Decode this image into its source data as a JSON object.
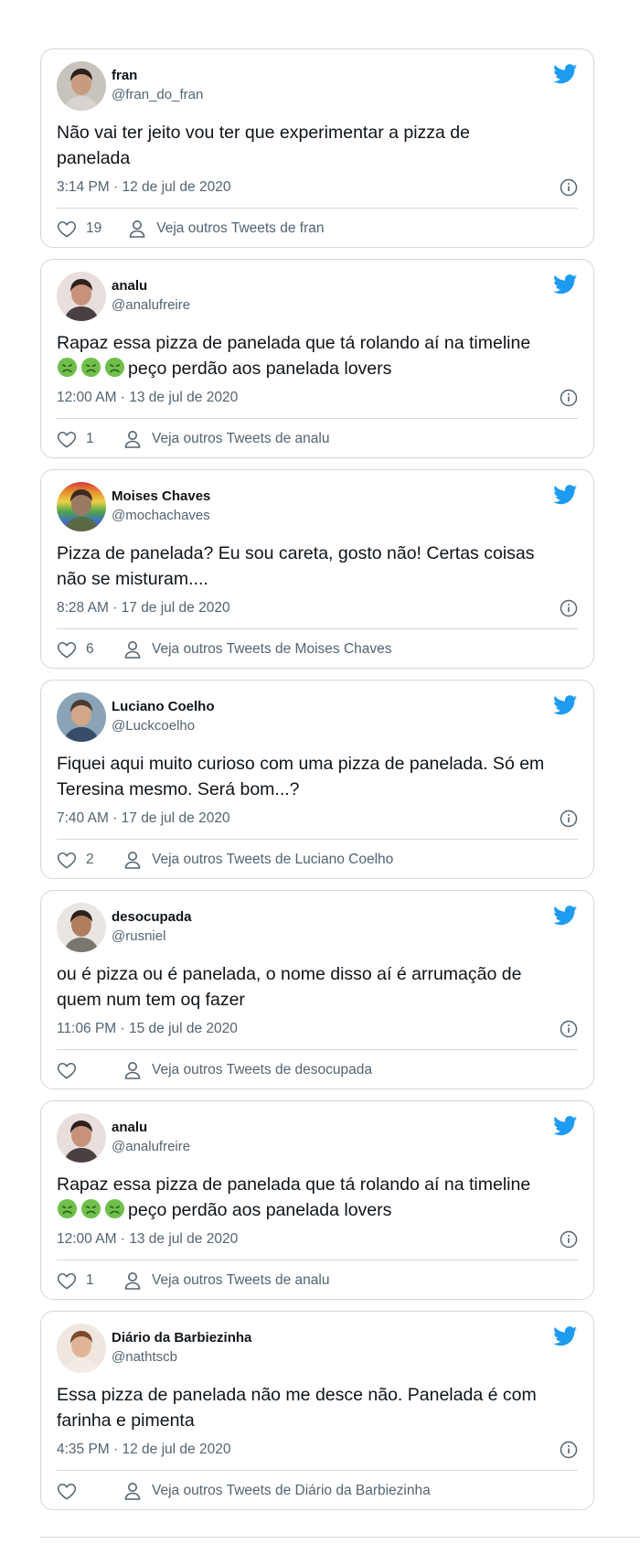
{
  "brand": {
    "twitter_blue": "#1d9bf0",
    "text": "#0f1419",
    "muted": "#536471",
    "border": "#cfd9de"
  },
  "icons": {
    "twitter": "twitter-bird-icon",
    "info": "info-icon",
    "like": "heart-icon",
    "profile": "person-icon",
    "emoji": "nauseated-face-emoji"
  },
  "tweets": [
    {
      "name": "fran",
      "handle": "@fran_do_fran",
      "line1": "Não vai ter jeito vou ter que experimentar a pizza de",
      "line2": "panelada",
      "emoji_count": 0,
      "time": "3:14 PM · 12 de jul de 2020",
      "likes": "19",
      "more": "Veja outros Tweets de fran",
      "avatar": {
        "bg": "#c9c3bd",
        "skin": "#c79c7e",
        "hair": "#2b201b",
        "shirt": "#d9d5d0"
      }
    },
    {
      "name": "analu",
      "handle": "@analufreire",
      "line1": "Rapaz essa pizza de panelada que tá rolando aí na timeline",
      "line2": "peço perdão aos panelada lovers",
      "emoji_count": 3,
      "time": "12:00 AM · 13 de jul de 2020",
      "likes": "1",
      "more": "Veja outros Tweets de analu",
      "avatar": {
        "bg": "#e8dfdc",
        "skin": "#c8927a",
        "hair": "#2e211d",
        "shirt": "#3a2f30"
      }
    },
    {
      "name": "Moises Chaves",
      "handle": "@mochachaves",
      "line1": "Pizza de panelada? Eu sou careta, gosto não! Certas coisas",
      "line2": "não se misturam....",
      "emoji_count": 0,
      "time": "8:28 AM · 17 de jul de 2020",
      "likes": "6",
      "more": "Veja outros Tweets de Moises Chaves",
      "avatar": {
        "bg": "rainbow",
        "skin": "#9a7a62",
        "hair": "#3a2a22",
        "shirt": "#5a6a3a"
      }
    },
    {
      "name": "Luciano Coelho",
      "handle": "@Luckcoelho",
      "line1": "Fiquei aqui muito curioso com uma pizza de panelada. Só em",
      "line2": "Teresina mesmo. Será bom...?",
      "emoji_count": 0,
      "time": "7:40 AM · 17 de jul de 2020",
      "likes": "2",
      "more": "Veja outros Tweets de Luciano Coelho",
      "avatar": {
        "bg": "#8aa3b6",
        "skin": "#d2a688",
        "hair": "#4a3a30",
        "shirt": "#2d4260"
      }
    },
    {
      "name": "desocupada",
      "handle": "@rusniel",
      "line1": "ou é pizza ou é panelada, o nome disso aí é arrumação de",
      "line2": "quem num tem oq fazer",
      "emoji_count": 0,
      "time": "11:06 PM · 15 de jul de 2020",
      "likes": "",
      "more": "Veja outros Tweets de desocupada",
      "avatar": {
        "bg": "#e9e6e2",
        "skin": "#b07d5e",
        "hair": "#2c221c",
        "shirt": "#6d6a60"
      }
    },
    {
      "name": "analu",
      "handle": "@analufreire",
      "line1": "Rapaz essa pizza de panelada que tá rolando aí na timeline",
      "line2": "peço perdão aos panelada lovers",
      "emoji_count": 3,
      "time": "12:00 AM · 13 de jul de 2020",
      "likes": "1",
      "more": "Veja outros Tweets de analu",
      "avatar": {
        "bg": "#e8dfdc",
        "skin": "#c8927a",
        "hair": "#2e211d",
        "shirt": "#3a2f30"
      }
    },
    {
      "name": "Diário da Barbiezinha",
      "handle": "@nathtscb",
      "line1": "Essa pizza de panelada não me desce não. Panelada é com",
      "line2": "farinha e pimenta",
      "emoji_count": 0,
      "time": "4:35 PM · 12 de jul de 2020",
      "likes": "",
      "more": "Veja outros Tweets de Diário da Barbiezinha",
      "avatar": {
        "bg": "#efe6df",
        "skin": "#e0b497",
        "hair": "#7a4a2c",
        "shirt": "#f2ece6"
      }
    }
  ]
}
